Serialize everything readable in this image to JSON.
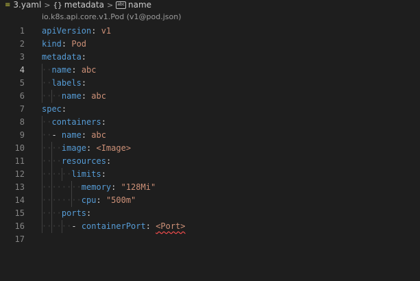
{
  "breadcrumb": {
    "file_icon": "yaml-file-icon",
    "file_name": "3.yaml",
    "separator": ">",
    "object_icon_glyph": "{}",
    "object_name": "metadata",
    "string_icon_glyph": "abc",
    "property_name": "name"
  },
  "schema_hint": "io.k8s.api.core.v1.Pod (v1@pod.json)",
  "colors": {
    "background": "#1e1e1e",
    "key": "#569cd6",
    "value": "#ce9178",
    "line_number": "#858585",
    "error_squiggle": "#f14c4c"
  },
  "editor": {
    "active_line": 4,
    "lines": [
      {
        "n": "1",
        "ws": "",
        "dash": "",
        "key": "apiVersion",
        "sep": ": ",
        "value": "v1"
      },
      {
        "n": "2",
        "ws": "",
        "dash": "",
        "key": "kind",
        "sep": ": ",
        "value": "Pod"
      },
      {
        "n": "3",
        "ws": "",
        "dash": "",
        "key": "metadata",
        "sep": ":",
        "value": ""
      },
      {
        "n": "4",
        "ws": "··",
        "dash": "",
        "key": "name",
        "sep": ": ",
        "value": "abc"
      },
      {
        "n": "5",
        "ws": "··",
        "dash": "",
        "key": "labels",
        "sep": ":",
        "value": ""
      },
      {
        "n": "6",
        "ws": "····",
        "dash": "",
        "key": "name",
        "sep": ": ",
        "value": "abc"
      },
      {
        "n": "7",
        "ws": "",
        "dash": "",
        "key": "spec",
        "sep": ":",
        "value": ""
      },
      {
        "n": "8",
        "ws": "··",
        "dash": "",
        "key": "containers",
        "sep": ":",
        "value": ""
      },
      {
        "n": "9",
        "ws": "··",
        "dash": "- ",
        "key": "name",
        "sep": ": ",
        "value": "abc"
      },
      {
        "n": "10",
        "ws": "····",
        "dash": "",
        "key": "image",
        "sep": ": ",
        "value": "<Image>"
      },
      {
        "n": "11",
        "ws": "····",
        "dash": "",
        "key": "resources",
        "sep": ":",
        "value": ""
      },
      {
        "n": "12",
        "ws": "······",
        "dash": "",
        "key": "limits",
        "sep": ":",
        "value": ""
      },
      {
        "n": "13",
        "ws": "········",
        "dash": "",
        "key": "memory",
        "sep": ": ",
        "value": "\"128Mi\""
      },
      {
        "n": "14",
        "ws": "········",
        "dash": "",
        "key": "cpu",
        "sep": ": ",
        "value": "\"500m\""
      },
      {
        "n": "15",
        "ws": "····",
        "dash": "",
        "key": "ports",
        "sep": ":",
        "value": ""
      },
      {
        "n": "16",
        "ws": "······",
        "dash": "- ",
        "key": "containerPort",
        "sep": ": ",
        "value": "<Port>",
        "error": true
      },
      {
        "n": "17",
        "ws": "",
        "dash": "",
        "key": "",
        "sep": "",
        "value": ""
      }
    ]
  }
}
